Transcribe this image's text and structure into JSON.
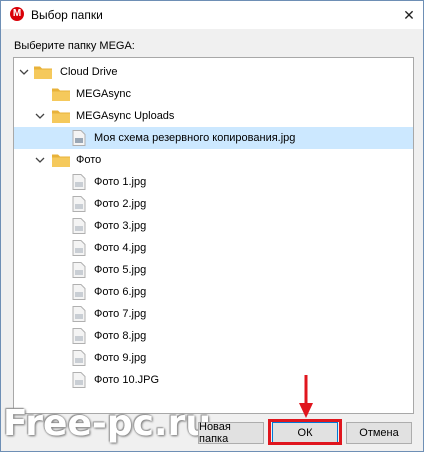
{
  "window": {
    "title": "Выбор папки",
    "app_icon_letter": "M",
    "close_glyph": "✕"
  },
  "prompt": "Выберите папку MEGA:",
  "tree": {
    "root": {
      "label": "Cloud Drive",
      "expanded": true
    },
    "megasync": {
      "label": "MEGAsync"
    },
    "uploads": {
      "label": "MEGAsync Uploads",
      "expanded": true
    },
    "backup_file": {
      "label": "Моя схема резервного копирования.jpg",
      "selected": true
    },
    "foto": {
      "label": "Фото",
      "expanded": true
    },
    "foto_files": [
      "Фото 1.jpg",
      "Фото 2.jpg",
      "Фото 3.jpg",
      "Фото 4.jpg",
      "Фото 5.jpg",
      "Фото 6.jpg",
      "Фото 7.jpg",
      "Фото 8.jpg",
      "Фото 9.jpg",
      "Фото 10.JPG"
    ]
  },
  "buttons": {
    "new_folder": "Новая папка",
    "ok": "ОК",
    "cancel": "Отмена"
  },
  "watermark": "Free-pc.ru",
  "colors": {
    "selection": "#cce8ff",
    "folder": "#f5c95c",
    "highlight": "#e0161e",
    "mega_red": "#d90007"
  }
}
